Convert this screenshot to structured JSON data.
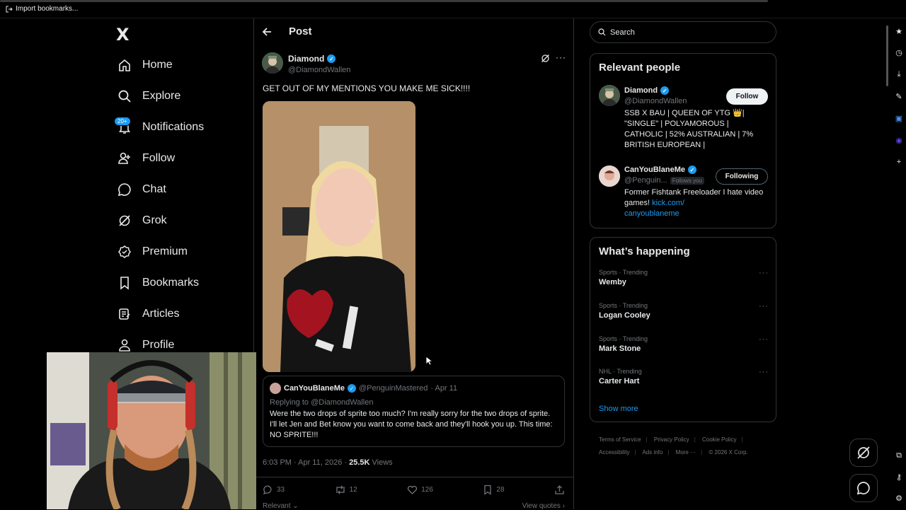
{
  "browser": {
    "import_bookmarks": "Import bookmarks..."
  },
  "nav": {
    "logo": "X",
    "items": [
      {
        "label": "Home",
        "icon": "home-icon"
      },
      {
        "label": "Explore",
        "icon": "search-icon"
      },
      {
        "label": "Notifications",
        "icon": "bell-icon"
      },
      {
        "label": "Follow",
        "icon": "follow-icon"
      },
      {
        "label": "Chat",
        "icon": "chat-icon"
      },
      {
        "label": "Grok",
        "icon": "grok-icon"
      },
      {
        "label": "Premium",
        "icon": "premium-icon"
      },
      {
        "label": "Bookmarks",
        "icon": "bookmark-icon"
      },
      {
        "label": "Articles",
        "icon": "articles-icon"
      },
      {
        "label": "Profile",
        "icon": "profile-icon"
      }
    ],
    "notifications_badge": "20+"
  },
  "post": {
    "header_title": "Post",
    "author_name": "Diamond",
    "author_handle": "@DiamondWallen",
    "text": "GET OUT OF MY MENTIONS YOU MAKE ME SICK!!!!",
    "quote": {
      "name": "CanYouBlaneMe",
      "handle": "@PenguinMastered",
      "date": "· Apr 11",
      "replying_to": "Replying to @DiamondWallen",
      "text": "Were the two drops of sprite too much? I'm really sorry for the two drops of sprite. I'll let Jen and Bet know you want to come back and they'll hook you up. This time: NO SPRITE!!!"
    },
    "timestamp": "6:03 PM · Apr 11, 2026 · ",
    "views_count": "25.5K",
    "views_label": " Views",
    "stats": {
      "replies": "33",
      "reposts": "12",
      "likes": "126",
      "bookmarks": "28"
    },
    "relevant": "Relevant",
    "view_quotes": "View quotes ›"
  },
  "search": {
    "placeholder": "Search"
  },
  "relevant_people": {
    "title": "Relevant people",
    "people": [
      {
        "name": "Diamond",
        "handle": "@DiamondWallen",
        "button": "Follow",
        "bio": "SSB X BAU | QUEEN OF YTG 👑| \"SINGLE\" | POLYAMOROUS | CATHOLIC | 52% AUSTRALIAN | 7% BRITISH EUROPEAN |"
      },
      {
        "name": "CanYouBlaneMe",
        "handle": "@Penguin...",
        "follows_you": "Follows you",
        "button": "Following",
        "bio": "Former Fishtank Freeloader I hate video games! ",
        "link_a": "kick.com/",
        "link_b": "canyoublaneme"
      }
    ]
  },
  "happening": {
    "title": "What’s happening",
    "trends": [
      {
        "meta": "Sports · Trending",
        "name": "Wemby"
      },
      {
        "meta": "Sports · Trending",
        "name": "Logan Cooley"
      },
      {
        "meta": "Sports · Trending",
        "name": "Mark Stone"
      },
      {
        "meta": "NHL · Trending",
        "name": "Carter Hart"
      }
    ],
    "show_more": "Show more"
  },
  "footer": {
    "links": [
      "Terms of Service",
      "Privacy Policy",
      "Cookie Policy",
      "Accessibility",
      "Ads info",
      "More ···",
      "© 2026 X Corp."
    ]
  }
}
